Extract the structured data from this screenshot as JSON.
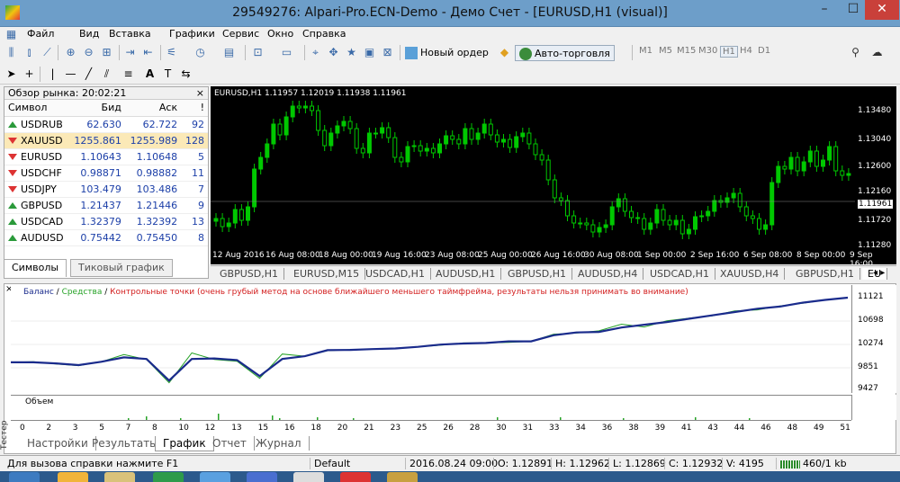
{
  "window": {
    "title": "29549276: Alpari-Pro.ECN-Demo - Демо Счет - [EURUSD,H1 (visual)]",
    "min": "–",
    "max": "☐",
    "close": "✕"
  },
  "menu": [
    "Файл",
    "Вид",
    "Вставка",
    "Графики",
    "Сервис",
    "Окно",
    "Справка"
  ],
  "toolbar": {
    "new_order": "Новый ордер",
    "autotrade": "Авто-торговля",
    "timeframes": [
      "M1",
      "M5",
      "M15",
      "M30",
      "H1",
      "H4",
      "D1"
    ],
    "draw_text": "A"
  },
  "market_watch": {
    "title": "Обзор рынка: 20:02:21",
    "close": "×",
    "columns": [
      "Символ",
      "Бид",
      "Аск",
      "!"
    ],
    "rows": [
      {
        "sym": "USDRUB",
        "bid": "62.630",
        "ask": "62.722",
        "sp": "92",
        "dir": "up"
      },
      {
        "sym": "XAUUSD",
        "bid": "1255.861",
        "ask": "1255.989",
        "sp": "128",
        "dir": "dn"
      },
      {
        "sym": "EURUSD",
        "bid": "1.10643",
        "ask": "1.10648",
        "sp": "5",
        "dir": "dn"
      },
      {
        "sym": "USDCHF",
        "bid": "0.98871",
        "ask": "0.98882",
        "sp": "11",
        "dir": "dn"
      },
      {
        "sym": "USDJPY",
        "bid": "103.479",
        "ask": "103.486",
        "sp": "7",
        "dir": "dn"
      },
      {
        "sym": "GBPUSD",
        "bid": "1.21437",
        "ask": "1.21446",
        "sp": "9",
        "dir": "up"
      },
      {
        "sym": "USDCAD",
        "bid": "1.32379",
        "ask": "1.32392",
        "sp": "13",
        "dir": "up"
      },
      {
        "sym": "AUDUSD",
        "bid": "0.75442",
        "ask": "0.75450",
        "sp": "8",
        "dir": "up"
      }
    ],
    "tabs": [
      "Символы",
      "Тиковый график"
    ]
  },
  "chart": {
    "header": "EURUSD,H1  1.11957 1.12019 1.11938 1.11961",
    "price_labels": [
      "1.13480",
      "1.13040",
      "1.12600",
      "1.12160",
      "1.11961",
      "1.11720",
      "1.11280"
    ],
    "date_labels": [
      "12 Aug 2016",
      "16 Aug 08:00",
      "18 Aug 00:00",
      "19 Aug 16:00",
      "23 Aug 08:00",
      "25 Aug 00:00",
      "26 Aug 16:00",
      "30 Aug 08:00",
      "1 Sep 00:00",
      "2 Sep 16:00",
      "6 Sep 08:00",
      "8 Sep 00:00",
      "9 Sep 16:00"
    ],
    "tabs": [
      "GBPUSD,H1",
      "EURUSD,M15",
      "USDCAD,H1",
      "AUDUSD,H1",
      "GBPUSD,H1",
      "AUDUSD,H4",
      "USDCAD,H1",
      "XAUUSD,H4",
      "GBPUSD,H1",
      "EU"
    ],
    "tab_arrows": "◂ ▸"
  },
  "tester": {
    "legend": {
      "balance": "Баланс",
      "sep": " / ",
      "equity": "Средства",
      "note": "Контрольные точки (очень грубый метод на основе ближайшего меньшего таймфрейма, результаты нельзя принимать во внимание)"
    },
    "y_labels": [
      "11121",
      "10698",
      "10274",
      "9851",
      "9427"
    ],
    "vol_label": "Объем",
    "x_labels": [
      "0",
      "2",
      "3",
      "5",
      "7",
      "8",
      "10",
      "12",
      "13",
      "15",
      "16",
      "18",
      "20",
      "21",
      "23",
      "25",
      "26",
      "28",
      "30",
      "31",
      "33",
      "34",
      "36",
      "38",
      "39",
      "41",
      "43",
      "44",
      "46",
      "48",
      "49",
      "51"
    ],
    "tabs": [
      "Настройки",
      "Результаты",
      "График",
      "Отчет",
      "Журнал"
    ],
    "side_label": "Тестер",
    "close": "×"
  },
  "chart_data": {
    "type": "line",
    "series": [
      {
        "name": "Баланс",
        "values": [
          9950,
          9950,
          9930,
          9900,
          9960,
          10040,
          10010,
          9620,
          10010,
          10020,
          9990,
          9700,
          10010,
          10060,
          10170,
          10175,
          10190,
          10200,
          10230,
          10270,
          10290,
          10300,
          10330,
          10330,
          10440,
          10490,
          10500,
          10580,
          10630,
          10680,
          10740,
          10800,
          10860,
          10920,
          10960,
          11030,
          11080,
          11121
        ]
      },
      {
        "name": "Средства",
        "values": [
          9950,
          9960,
          9920,
          9890,
          9960,
          10090,
          10000,
          9580,
          10120,
          10000,
          9970,
          9660,
          10100,
          10060,
          10160,
          10180,
          10190,
          10200,
          10230,
          10260,
          10300,
          10300,
          10310,
          10330,
          10460,
          10480,
          10520,
          10640,
          10590,
          10700,
          10750,
          10790,
          10880,
          10900,
          10970,
          11020,
          11080,
          11121
        ]
      }
    ],
    "ylim": [
      9427,
      11121
    ]
  },
  "status": {
    "help": "Для вызова справки нажмите F1",
    "profile": "Default",
    "datetime": "2016.08.24 09:00",
    "o": "O: 1.12891",
    "h": "H: 1.12962",
    "l": "L: 1.12869",
    "c": "C: 1.12932",
    "v": "V: 4195",
    "traffic": "460/1 kb"
  },
  "colors": {
    "balance": "#1a2b8c",
    "equity": "#27a327",
    "note": "#d32020",
    "candles": "#00c800"
  }
}
